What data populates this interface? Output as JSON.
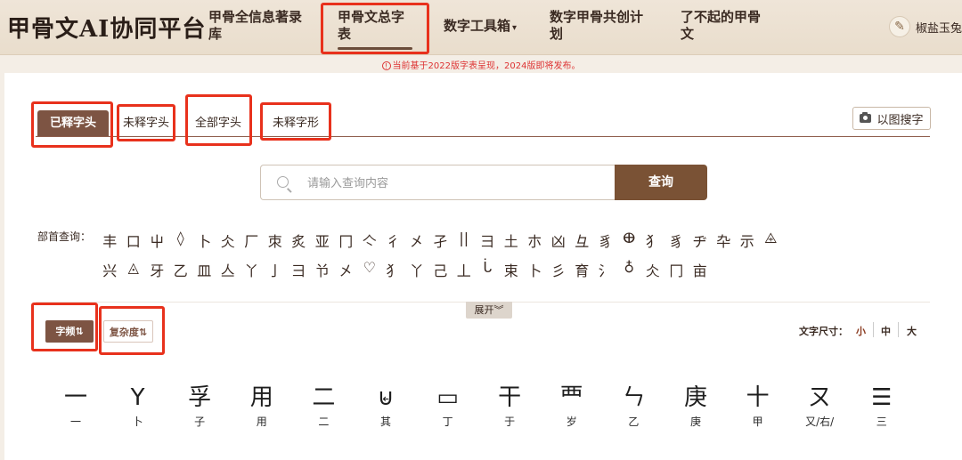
{
  "header": {
    "brand": "甲骨文AI协同平台",
    "nav": [
      {
        "line1": "甲骨全信息著录",
        "line2": "库"
      },
      {
        "line1": "甲骨文总字",
        "line2": "表"
      },
      {
        "line1": "数字工具箱",
        "line2": ""
      },
      {
        "line1": "数字甲骨共创计",
        "line2": "划"
      },
      {
        "line1": "了不起的甲骨",
        "line2": "文"
      }
    ],
    "caret": "▾",
    "user": "椒盐玉兔"
  },
  "notice": "当前基于2022版字表呈现，2024版即将发布。",
  "tabs": [
    "已释字头",
    "未释字头",
    "全部字头",
    "未释字形"
  ],
  "image_search_label": "以图搜字",
  "search": {
    "placeholder": "请输入查询内容",
    "button": "查询"
  },
  "radicals": {
    "label": "部首查询：",
    "row1": [
      "丰",
      "口",
      "屮",
      "◊",
      "卜",
      "仌",
      "厂",
      "朿",
      "炙",
      "亚",
      "冂",
      "亽",
      "彳",
      "㐅",
      "孑",
      "||",
      "彐",
      "土",
      "朩",
      "凶",
      "彑",
      "豸",
      "ⴲ",
      "犭",
      "豸",
      "ヂ",
      "卆",
      "示",
      "⨹"
    ],
    "row2": [
      "兴",
      "◬",
      "牙",
      "乙",
      "皿",
      "亼",
      "丫",
      "亅",
      "彐",
      "兯",
      "㐅",
      "♡",
      "犭",
      "丫",
      "己",
      "丄",
      "ᒑ",
      "束",
      "卜",
      "彡",
      "育",
      "氵",
      "♁",
      "仌",
      "冂",
      "亩"
    ]
  },
  "expand_label": "展开︾",
  "sort": {
    "frequency": "字频⇅",
    "complexity": "复杂度⇅"
  },
  "font_size": {
    "label": "文字尺寸：",
    "small": "小",
    "medium": "中",
    "large": "大"
  },
  "glyphs": [
    {
      "shape": "一",
      "label": "一"
    },
    {
      "shape": "Y",
      "label": "卜"
    },
    {
      "shape": "孚",
      "label": "子"
    },
    {
      "shape": "用",
      "label": "用"
    },
    {
      "shape": "二",
      "label": "二"
    },
    {
      "shape": "⊌",
      "label": "其"
    },
    {
      "shape": "▭",
      "label": "丁"
    },
    {
      "shape": "干",
      "label": "于"
    },
    {
      "shape": "⻃",
      "label": "岁"
    },
    {
      "shape": "ㄣ",
      "label": "乙"
    },
    {
      "shape": "庚",
      "label": "庚"
    },
    {
      "shape": "十",
      "label": "甲"
    },
    {
      "shape": "ㄡ",
      "label": "又/右/"
    },
    {
      "shape": "☰",
      "label": "三"
    }
  ],
  "colors": {
    "accent": "#7d5443",
    "annotation": "#e8311c",
    "notice": "#dd3333"
  }
}
